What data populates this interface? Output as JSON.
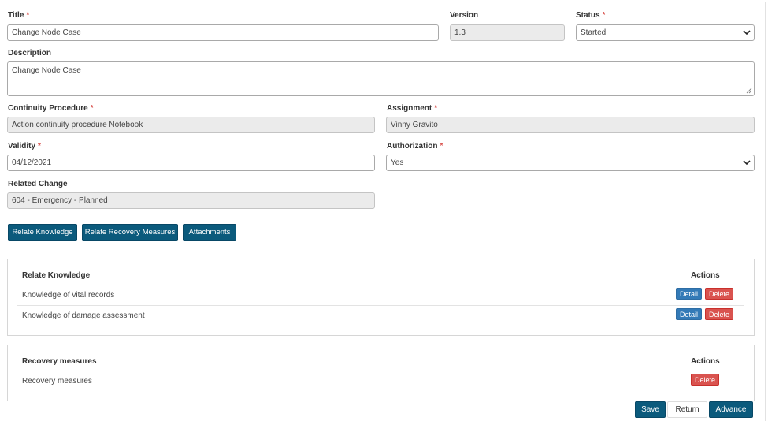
{
  "form": {
    "title_label": "Title",
    "title_value": "Change Node Case",
    "version_label": "Version",
    "version_value": "1.3",
    "status_label": "Status",
    "status_value": "Started",
    "description_label": "Description",
    "description_value": "Change Node Case",
    "continuity_label": "Continuity Procedure",
    "continuity_value": "Action continuity procedure Notebook",
    "assignment_label": "Assignment",
    "assignment_value": "Vinny Gravito",
    "validity_label": "Validity",
    "validity_value": "04/12/2021",
    "authorization_label": "Authorization",
    "authorization_value": "Yes",
    "related_change_label": "Related Change",
    "related_change_value": "604 - Emergency - Planned",
    "required_mark": "*"
  },
  "buttons": {
    "relate_knowledge": "Relate Knowledge",
    "relate_recovery": "Relate Recovery Measures",
    "attachments": "Attachments"
  },
  "knowledge_panel": {
    "header": "Relate Knowledge",
    "actions_header": "Actions",
    "rows": [
      {
        "name": "Knowledge of vital records",
        "detail": "Detail",
        "delete": "Delete"
      },
      {
        "name": "Knowledge of damage assessment",
        "detail": "Detail",
        "delete": "Delete"
      }
    ]
  },
  "recovery_panel": {
    "header": "Recovery measures",
    "actions_header": "Actions",
    "rows": [
      {
        "name": "Recovery measures",
        "delete": "Delete"
      }
    ]
  },
  "footer": {
    "save": "Save",
    "return": "Return",
    "advance": "Advance"
  },
  "colors": {
    "primary": "#0b5a7c",
    "detail": "#337ab7",
    "delete": "#d9534f",
    "required": "#d9534f"
  }
}
